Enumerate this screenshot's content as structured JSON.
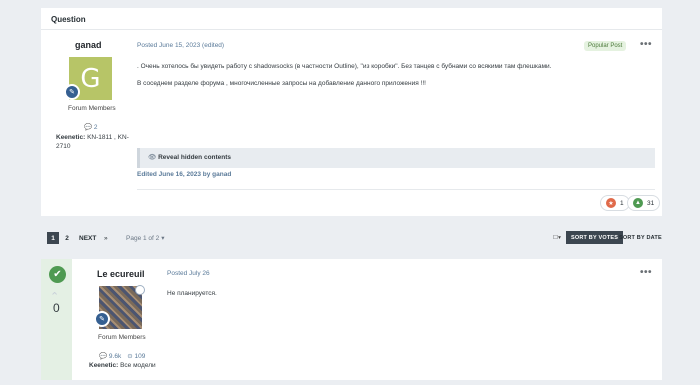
{
  "question": {
    "header": "Question",
    "author": {
      "name": "ganad",
      "avatar_letter": "G",
      "group": "Forum Members",
      "posts": "2",
      "keenetic_label": "Keenetic:",
      "keenetic_value": "KN-1811 , KN-2710"
    },
    "meta": "Posted June 15, 2023 (edited)",
    "badge": "Popular Post",
    "more": "•••",
    "body": [
      ". Очень хотелось бы увидеть работу с shadowsocks (в частности Outline), \"из коробки\". Без танцев с бубнами со всякими там флешками.",
      "В соседнем разделе форума , многочисленные запросы на добавление данного  приложения !!!"
    ],
    "hidden": "Reveal hidden contents",
    "edited": "Edited June 16, 2023 by ganad",
    "reactions": [
      {
        "count": "1",
        "color": "#e06a4a"
      },
      {
        "count": "31",
        "color": "#4f9a52"
      }
    ]
  },
  "pagination": {
    "pages": [
      "1",
      "2"
    ],
    "next": "NEXT",
    "last": "»",
    "page_of": "Page 1 of 2",
    "sort_votes": "SORT BY VOTES",
    "sort_date": "SORT BY DATE"
  },
  "answer": {
    "author": {
      "name": "Le ecureuil",
      "group": "Forum Members",
      "posts": "9.6k",
      "reputation": "109",
      "keenetic_label": "Keenetic:",
      "keenetic_value": "Все модели"
    },
    "meta": "Posted July 26",
    "more": "•••",
    "body": "Не планируется.",
    "votes": "0"
  },
  "colors": {
    "accent": "#4f9a52",
    "rank": "#355f91",
    "meta": "#5a7a99"
  }
}
